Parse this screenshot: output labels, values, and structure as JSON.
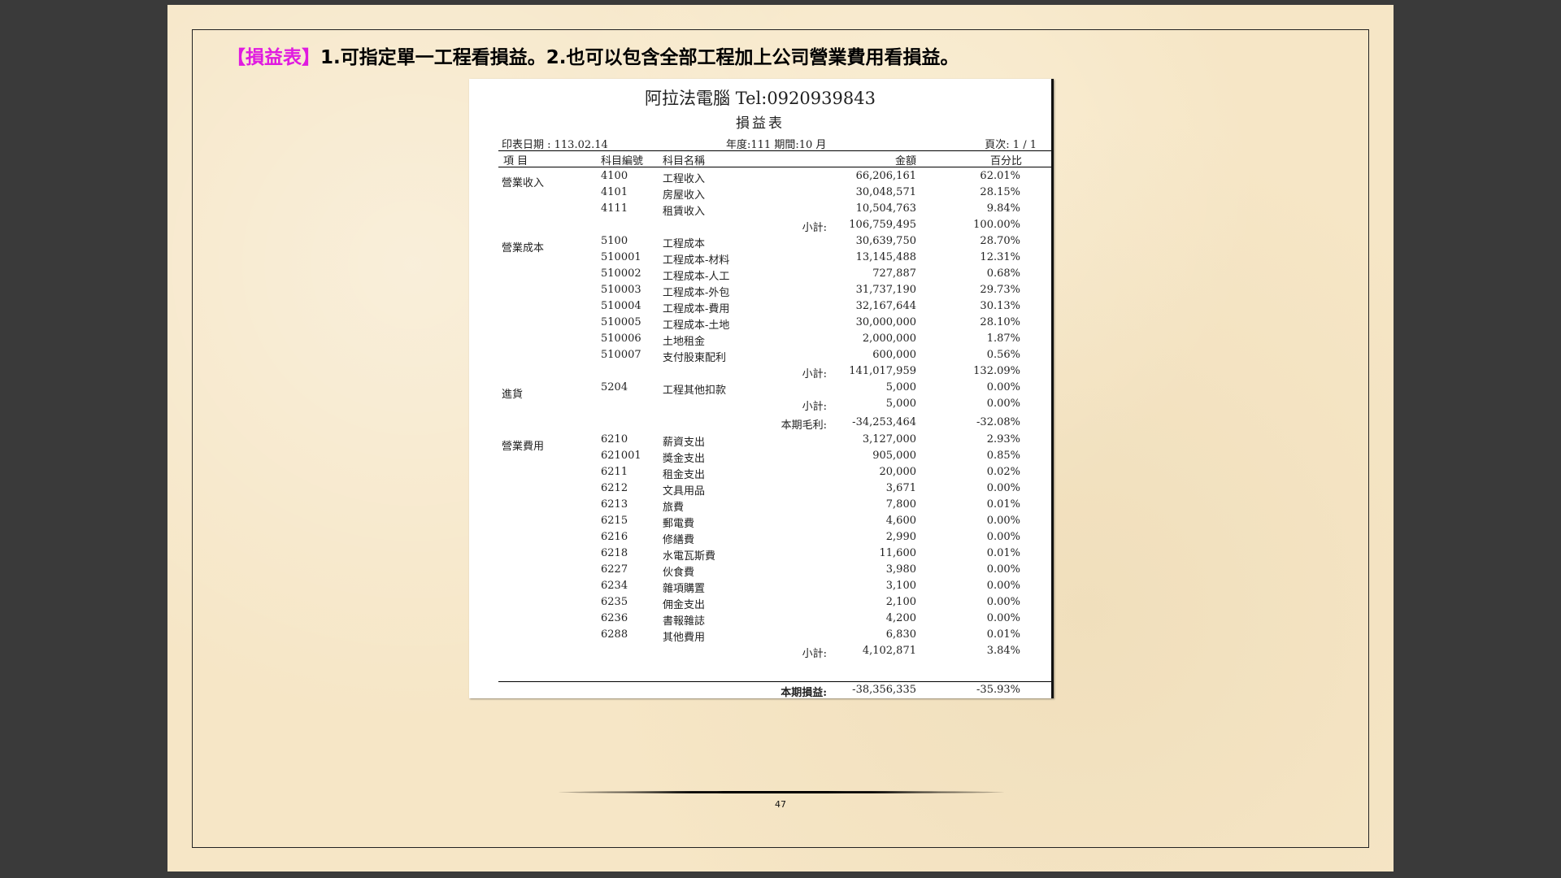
{
  "headline": {
    "tag": "【損益表】",
    "text": "1.可指定單一工程看損益。2.也可以包含全部工程加上公司營業費用看損益。"
  },
  "report": {
    "title": "阿拉法電腦 Tel:0920939843",
    "subtitle": "損益表",
    "print_date": "印表日期 : 113.02.14",
    "period": "年度:111 期間:10 月",
    "page": "頁次: 1 / 1",
    "columns": [
      "項 目",
      "科目編號",
      "科目名稱",
      "金額",
      "百分比"
    ],
    "rows": [
      {
        "section": "營業收入",
        "code": "4100",
        "name": "工程收入",
        "label": "",
        "amount": "66,206,161",
        "pct": "62.01%"
      },
      {
        "section": "",
        "code": "4101",
        "name": "房屋收入",
        "label": "",
        "amount": "30,048,571",
        "pct": "28.15%"
      },
      {
        "section": "",
        "code": "4111",
        "name": "租賃收入",
        "label": "",
        "amount": "10,504,763",
        "pct": "9.84%"
      },
      {
        "section": "",
        "code": "",
        "name": "",
        "label": "小計:",
        "amount": "106,759,495",
        "pct": "100.00%"
      },
      {
        "section": "營業成本",
        "code": "5100",
        "name": "工程成本",
        "label": "",
        "amount": "30,639,750",
        "pct": "28.70%"
      },
      {
        "section": "",
        "code": "510001",
        "name": "工程成本-材料",
        "label": "",
        "amount": "13,145,488",
        "pct": "12.31%"
      },
      {
        "section": "",
        "code": "510002",
        "name": "工程成本-人工",
        "label": "",
        "amount": "727,887",
        "pct": "0.68%"
      },
      {
        "section": "",
        "code": "510003",
        "name": "工程成本-外包",
        "label": "",
        "amount": "31,737,190",
        "pct": "29.73%"
      },
      {
        "section": "",
        "code": "510004",
        "name": "工程成本-費用",
        "label": "",
        "amount": "32,167,644",
        "pct": "30.13%"
      },
      {
        "section": "",
        "code": "510005",
        "name": "工程成本-土地",
        "label": "",
        "amount": "30,000,000",
        "pct": "28.10%"
      },
      {
        "section": "",
        "code": "510006",
        "name": "土地租金",
        "label": "",
        "amount": "2,000,000",
        "pct": "1.87%"
      },
      {
        "section": "",
        "code": "510007",
        "name": "支付股東配利",
        "label": "",
        "amount": "600,000",
        "pct": "0.56%"
      },
      {
        "section": "",
        "code": "",
        "name": "",
        "label": "小計:",
        "amount": "141,017,959",
        "pct": "132.09%"
      },
      {
        "section": "進貨",
        "code": "5204",
        "name": "工程其他扣款",
        "label": "",
        "amount": "5,000",
        "pct": "0.00%"
      },
      {
        "section": "",
        "code": "",
        "name": "",
        "label": "小計:",
        "amount": "5,000",
        "pct": "0.00%"
      },
      {
        "section": "",
        "code": "",
        "name": "",
        "label": "本期毛利:",
        "amount": "-34,253,464",
        "pct": "-32.08%"
      },
      {
        "section": "營業費用",
        "code": "6210",
        "name": "薪資支出",
        "label": "",
        "amount": "3,127,000",
        "pct": "2.93%"
      },
      {
        "section": "",
        "code": "621001",
        "name": "獎金支出",
        "label": "",
        "amount": "905,000",
        "pct": "0.85%"
      },
      {
        "section": "",
        "code": "6211",
        "name": "租金支出",
        "label": "",
        "amount": "20,000",
        "pct": "0.02%"
      },
      {
        "section": "",
        "code": "6212",
        "name": "文具用品",
        "label": "",
        "amount": "3,671",
        "pct": "0.00%"
      },
      {
        "section": "",
        "code": "6213",
        "name": "旅費",
        "label": "",
        "amount": "7,800",
        "pct": "0.01%"
      },
      {
        "section": "",
        "code": "6215",
        "name": "郵電費",
        "label": "",
        "amount": "4,600",
        "pct": "0.00%"
      },
      {
        "section": "",
        "code": "6216",
        "name": "修繕費",
        "label": "",
        "amount": "2,990",
        "pct": "0.00%"
      },
      {
        "section": "",
        "code": "6218",
        "name": "水電瓦斯費",
        "label": "",
        "amount": "11,600",
        "pct": "0.01%"
      },
      {
        "section": "",
        "code": "6227",
        "name": "伙食費",
        "label": "",
        "amount": "3,980",
        "pct": "0.00%"
      },
      {
        "section": "",
        "code": "6234",
        "name": "雜項購置",
        "label": "",
        "amount": "3,100",
        "pct": "0.00%"
      },
      {
        "section": "",
        "code": "6235",
        "name": "佣金支出",
        "label": "",
        "amount": "2,100",
        "pct": "0.00%"
      },
      {
        "section": "",
        "code": "6236",
        "name": "書報雜誌",
        "label": "",
        "amount": "4,200",
        "pct": "0.00%"
      },
      {
        "section": "",
        "code": "6288",
        "name": "其他費用",
        "label": "",
        "amount": "6,830",
        "pct": "0.01%"
      },
      {
        "section": "",
        "code": "",
        "name": "",
        "label": "小計:",
        "amount": "4,102,871",
        "pct": "3.84%"
      }
    ],
    "total": {
      "label": "本期損益:",
      "amount": "-38,356,335",
      "pct": "-35.93%"
    }
  },
  "page_number": "47"
}
